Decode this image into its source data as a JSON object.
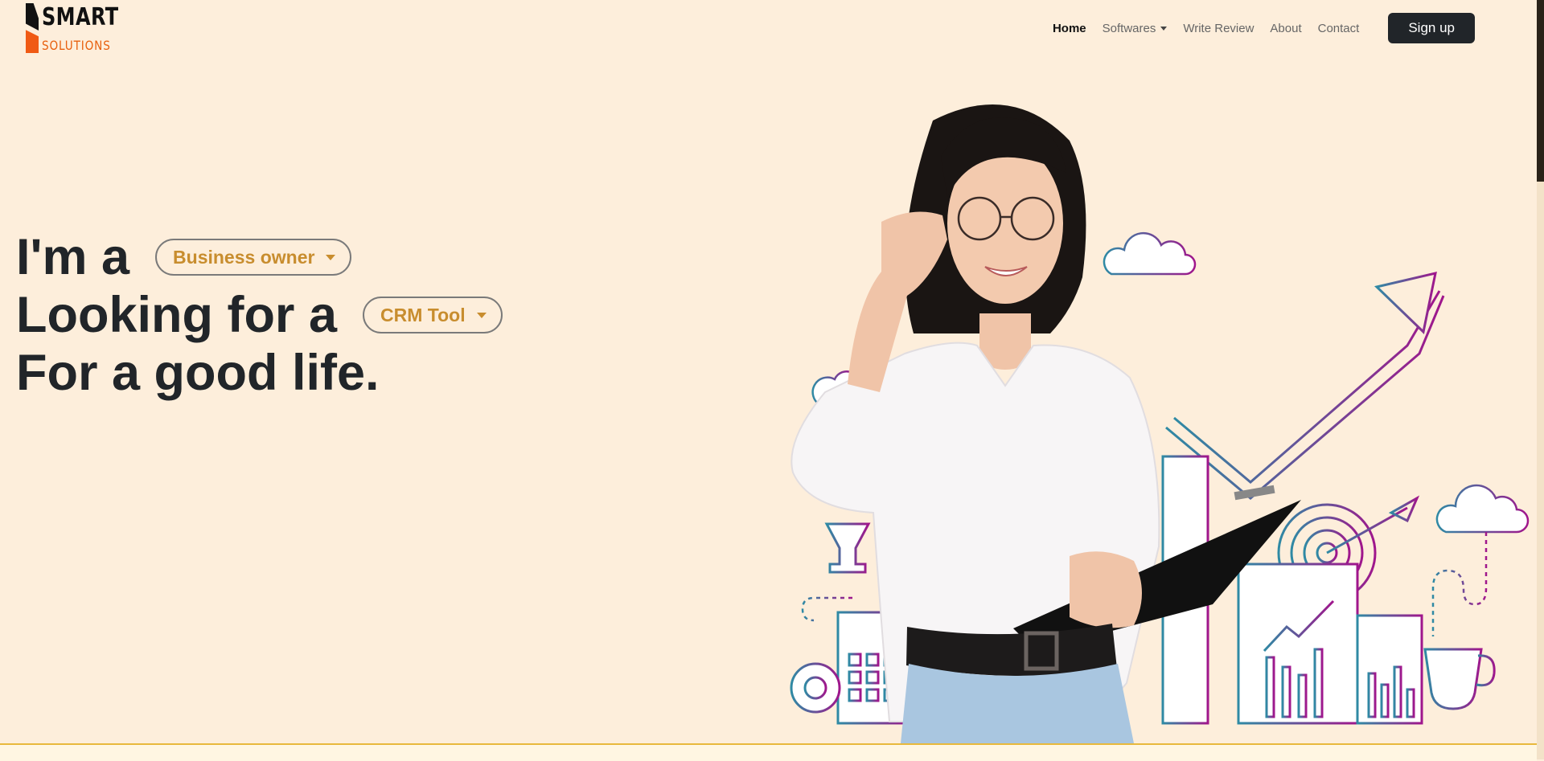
{
  "brand": {
    "name_top": "SMART",
    "name_bottom": "SOLUTIONS"
  },
  "nav": {
    "items": [
      "Home",
      "Softwares",
      "Write Review",
      "About",
      "Contact"
    ],
    "signup_label": "Sign up"
  },
  "hero": {
    "line1_prefix": "I'm a",
    "role_select": "Business owner",
    "line2_prefix": "Looking for a",
    "tool_select": "CRM Tool",
    "line3": "For a good life."
  },
  "colors": {
    "background": "#fdeedb",
    "accent_text": "#c88d2e",
    "brand_orange": "#f05a14",
    "button_dark": "#212529",
    "illustration_magenta": "#a0168c",
    "illustration_teal": "#2f8aa4"
  },
  "icons": [
    "caret-down-icon",
    "growth-arrow-icon",
    "cloud-icon",
    "target-icon",
    "coffee-cup-icon",
    "gear-icon",
    "bar-chart-icon"
  ]
}
